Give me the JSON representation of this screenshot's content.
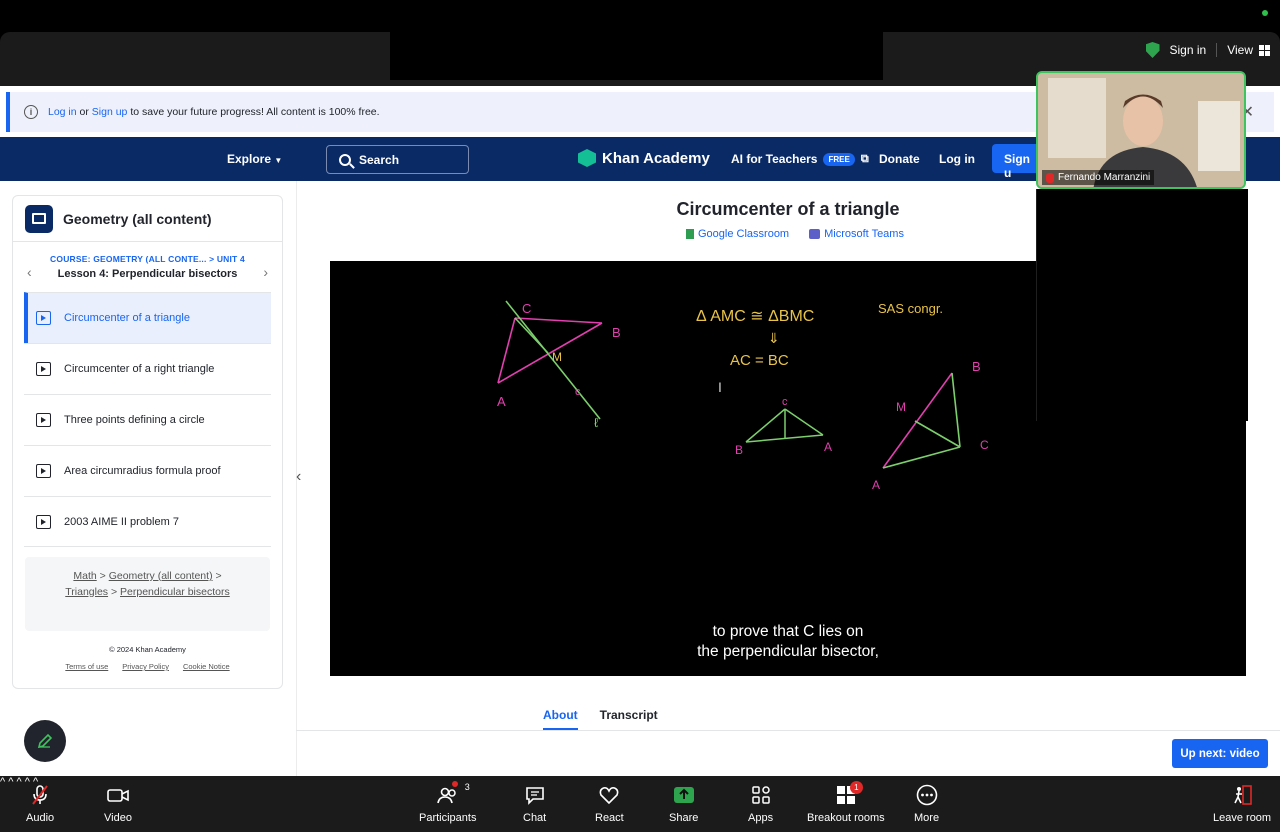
{
  "zoom_top": {
    "sign_in": "Sign in",
    "view": "View"
  },
  "banner": {
    "login": "Log in",
    "or": " or ",
    "signup": "Sign up",
    "rest": " to save your future progress! All content is 100% free."
  },
  "ka_nav": {
    "explore": "Explore",
    "search": "Search",
    "logo": "Khan Academy",
    "ai_teachers": "AI for Teachers",
    "free": "FREE",
    "donate": "Donate",
    "login": "Log in",
    "signup": "Sign u"
  },
  "sidebar": {
    "title": "Geometry (all content)",
    "course_line": "COURSE: GEOMETRY (ALL CONTE... > UNIT 4",
    "lesson": "Lesson 4: Perpendicular bisectors",
    "items": [
      {
        "label": "Circumcenter of a triangle"
      },
      {
        "label": "Circumcenter of a right triangle"
      },
      {
        "label": "Three points defining a circle"
      },
      {
        "label": "Area circumradius formula proof"
      },
      {
        "label": "2003 AIME II problem 7"
      }
    ],
    "breadcrumbs": {
      "math": "Math",
      "geometry": "Geometry (all content)",
      "triangles": "Triangles",
      "perp": "Perpendicular bisectors",
      "sep": " > "
    },
    "copyright": "© 2024 Khan Academy",
    "footer_links": [
      "Terms of use",
      "Privacy Policy",
      "Cookie Notice"
    ]
  },
  "main": {
    "title": "Circumcenter of a triangle",
    "google_classroom": "Google Classroom",
    "microsoft_teams": "Microsoft Teams",
    "caption_line1": "to prove that C lies on",
    "caption_line2": "the perpendicular bisector,",
    "tabs": [
      "About",
      "Transcript"
    ],
    "up_next": "Up next: video"
  },
  "video_board": {
    "eq1_a": "Δ AMC ≅ ΔBMC",
    "eq1_b": "SAS congr.",
    "arrow": "⇓",
    "eq2": "AC = BC",
    "labels": {
      "C": "C",
      "B": "B",
      "A": "A",
      "M": "M",
      "l": "ℓ",
      "c": "c"
    }
  },
  "participant": {
    "name": "Fernando Marranzini"
  },
  "zoom_bottom": {
    "audio": "Audio",
    "video": "Video",
    "participants": "Participants",
    "participants_count": "3",
    "chat": "Chat",
    "react": "React",
    "share": "Share",
    "apps": "Apps",
    "breakout": "Breakout rooms",
    "breakout_badge": "1",
    "more": "More",
    "leave": "Leave room"
  },
  "colors": {
    "ka_blue": "#1865f2",
    "ka_navy": "#0a2a66",
    "zoom_bar": "#1b1b1b",
    "share_green": "#2ea44f",
    "chalk_pink": "#e23fb0",
    "chalk_yellow": "#e8c34a",
    "chalk_green": "#7ccf6d"
  }
}
